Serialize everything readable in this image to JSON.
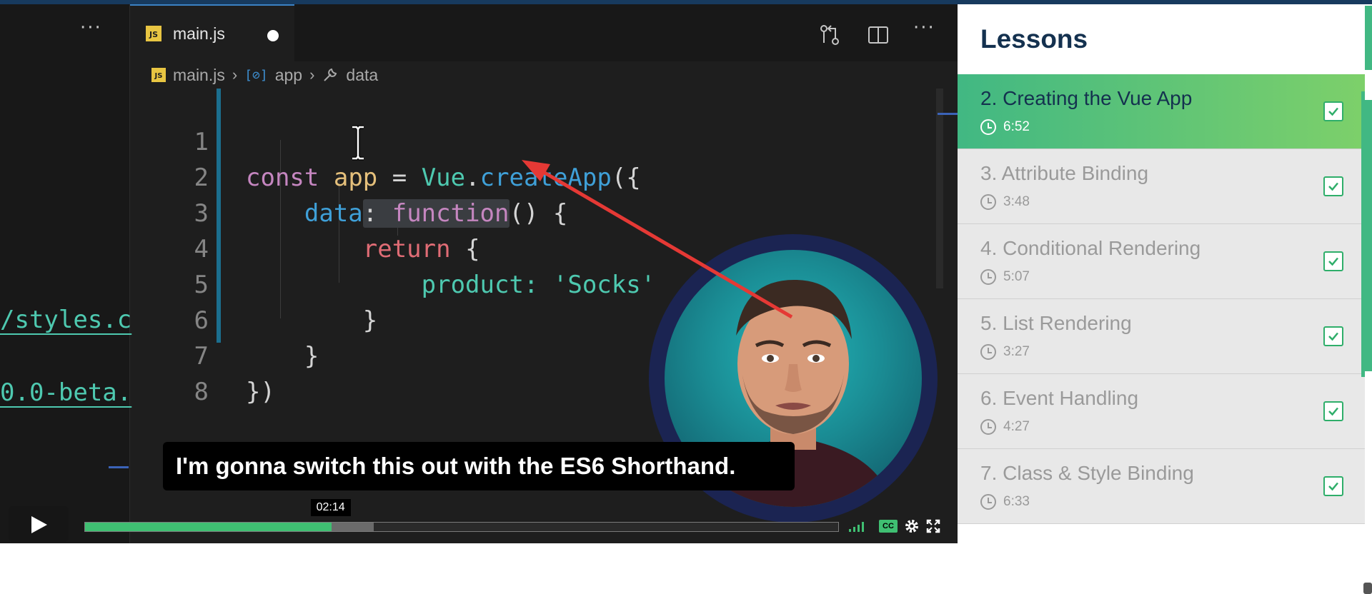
{
  "editor": {
    "tab_label": "main.js",
    "breadcrumb": [
      "main.js",
      "app",
      "data"
    ],
    "left_snippets": [
      "/styles.c",
      "0.0-beta."
    ],
    "lines": [
      {
        "n": "1"
      },
      {
        "n": "2"
      },
      {
        "n": "3"
      },
      {
        "n": "4"
      },
      {
        "n": "5"
      },
      {
        "n": "6"
      },
      {
        "n": "7"
      },
      {
        "n": "8"
      }
    ],
    "tokens": {
      "const": "const",
      "app": "app",
      "eq": " = ",
      "vue": "Vue",
      "dot": ".",
      "createApp": "createApp",
      "open": "({",
      "data": "data",
      "colon": ": ",
      "function": "function",
      "fnargs": "() {",
      "return": "return",
      "brace": " {",
      "product": "product",
      "pcolon": ": ",
      "socks": "'Socks'",
      "close5": "}",
      "close6": "}",
      "close7": "})"
    }
  },
  "video": {
    "caption": "I'm gonna switch this out with the ES6 Shorthand.",
    "time_tooltip": "02:14",
    "progress_played": 0.327,
    "progress_buffered": 0.383,
    "cc_label": "CC"
  },
  "sidebar": {
    "title": "Lessons",
    "lessons": [
      {
        "title": "2. Creating the Vue App",
        "duration": "6:52",
        "active": true
      },
      {
        "title": "3. Attribute Binding",
        "duration": "3:48"
      },
      {
        "title": "4. Conditional Rendering",
        "duration": "5:07"
      },
      {
        "title": "5. List Rendering",
        "duration": "3:27"
      },
      {
        "title": "6. Event Handling",
        "duration": "4:27"
      },
      {
        "title": "7. Class & Style Binding",
        "duration": "6:33"
      }
    ]
  },
  "colors": {
    "accent_green": "#41b883",
    "sidebar_title": "#14314f",
    "editor_bg": "#1e1e1e"
  },
  "icons": [
    "more-icon",
    "js-file-icon",
    "compare-changes-icon",
    "split-editor-icon",
    "symbol-icon",
    "wrench-icon",
    "text-cursor-icon",
    "play-icon",
    "volume-icon",
    "cc-icon",
    "gear-icon",
    "fullscreen-icon",
    "clock-icon",
    "checkbox-checked-icon"
  ]
}
